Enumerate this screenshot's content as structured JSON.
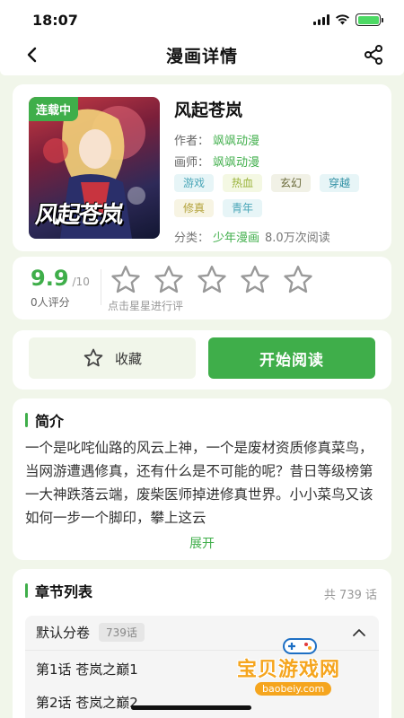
{
  "status_bar": {
    "time": "18:07"
  },
  "nav": {
    "title": "漫画详情"
  },
  "comic": {
    "status_badge": "连载中",
    "cover_logo": "风起苍岚",
    "title": "风起苍岚",
    "author_label": "作者：",
    "author": "飒飒动漫",
    "artist_label": "画师：",
    "artist": "飒飒动漫",
    "tags": [
      {
        "label": "游戏",
        "bg": "#e7f5f7",
        "color": "#4aa6b8"
      },
      {
        "label": "热血",
        "bg": "#f4f8e3",
        "color": "#9ab33a"
      },
      {
        "label": "玄幻",
        "bg": "#f1f1e6",
        "color": "#6a6a3a"
      },
      {
        "label": "穿越",
        "bg": "#e7f5f7",
        "color": "#2f8fa3"
      },
      {
        "label": "修真",
        "bg": "#f7f4e3",
        "color": "#b3a23a"
      },
      {
        "label": "青年",
        "bg": "#e7f5f7",
        "color": "#4aa6b8"
      }
    ],
    "category_label": "分类：",
    "category": "少年漫画",
    "reads": "8.0万次阅读"
  },
  "rating": {
    "score": "9.9",
    "max": "/10",
    "count": "0人评分",
    "hint": "点击星星进行评",
    "stars_filled": 0
  },
  "actions": {
    "favorite_label": "收藏",
    "read_label": "开始阅读"
  },
  "intro": {
    "title": "简介",
    "text": "一个是叱咤仙路的风云上神，一个是废材资质修真菜鸟，当网游遭遇修真，还有什么是不可能的呢？昔日等级榜第一大神跌落云端，废柴医师掉进修真世界。小小菜鸟又该如何一步一个脚印，攀上这云",
    "expand": "展开"
  },
  "chapters": {
    "title": "章节列表",
    "total": "共 739 话",
    "volume_name": "默认分卷",
    "volume_count": "739话",
    "items": [
      "第1话  苍岚之巅1",
      "第2话  苍岚之巅2"
    ]
  },
  "watermark": {
    "text": "宝贝游戏网",
    "url": "baobeiy.com"
  },
  "colors": {
    "accent": "#3fae4a",
    "page_bg": "#f1f6ea"
  }
}
